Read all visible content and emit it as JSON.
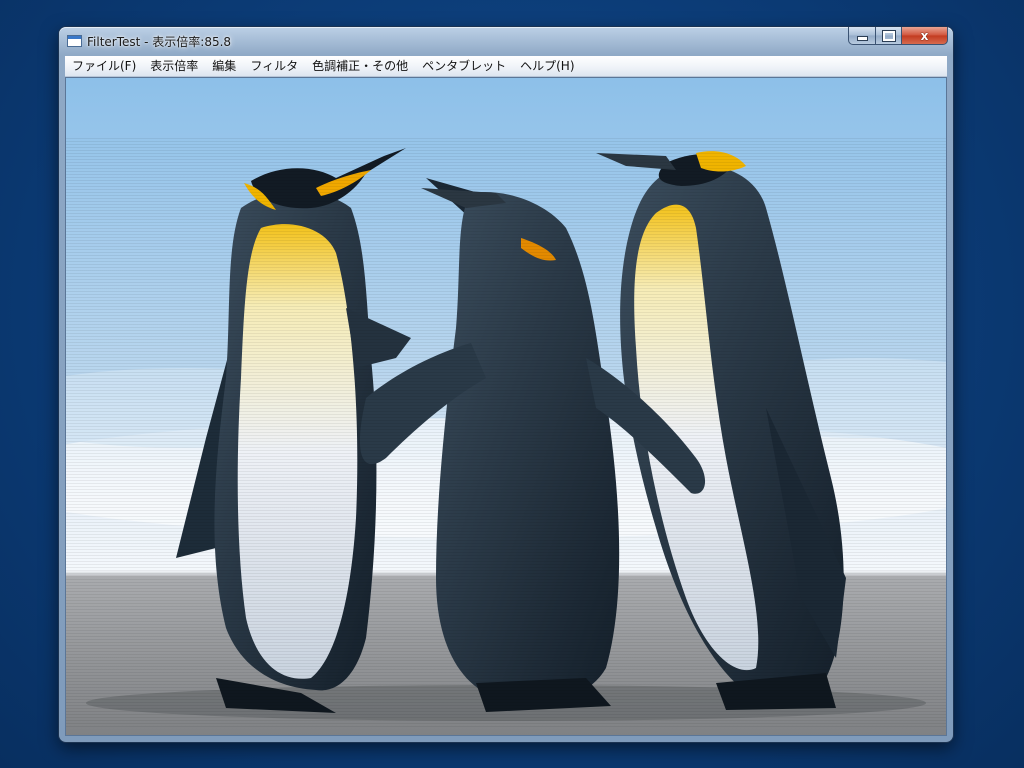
{
  "window": {
    "title": "FilterTest - 表示倍率:85.8",
    "caption_buttons": {
      "minimize_icon": "minimize-icon",
      "maximize_icon": "maximize-icon",
      "close_icon": "close-icon",
      "close_glyph": "x"
    }
  },
  "menu": {
    "items": [
      {
        "label": "ファイル(F)"
      },
      {
        "label": "表示倍率"
      },
      {
        "label": "編集"
      },
      {
        "label": "フィルタ"
      },
      {
        "label": "色調補正・その他"
      },
      {
        "label": "ペンタブレット"
      },
      {
        "label": "ヘルプ(H)"
      }
    ]
  },
  "canvas": {
    "content": "three-penguins-image",
    "colors": {
      "sky_top": "#8fc2ea",
      "sky_bottom": "#d8e9f6",
      "snow": "#f3f7fb",
      "ground": "#8e9093",
      "penguin_dark": "#1f3140",
      "penguin_belly": "#e8edf3",
      "penguin_yellow": "#f0b400"
    }
  }
}
